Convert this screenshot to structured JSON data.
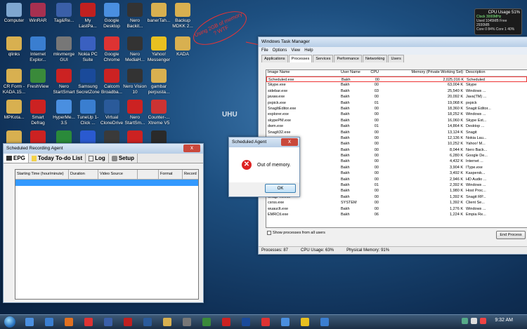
{
  "desktop_icons": [
    {
      "label": "Computer",
      "color": "#7fa7d0"
    },
    {
      "label": "WinRAR",
      "color": "#a73050"
    },
    {
      "label": "Tag&Re...",
      "color": "#3a5fa8"
    },
    {
      "label": "My LastPa...",
      "color": "#c02020"
    },
    {
      "label": "Google Desktop",
      "color": "#4a8fe0"
    },
    {
      "label": "Nero Backit...",
      "color": "#333"
    },
    {
      "label": "banerTah...",
      "color": "#d8b050"
    },
    {
      "label": "Backup MDKK 2...",
      "color": "#d8b050"
    },
    {
      "label": "qlinks",
      "color": "#d8b050"
    },
    {
      "label": "Internet Explor...",
      "color": "#3a7ed0"
    },
    {
      "label": "mkvmerge GUI",
      "color": "#777"
    },
    {
      "label": "Nokia PC Suite",
      "color": "#3a60c0"
    },
    {
      "label": "Google Chrome",
      "color": "#d33"
    },
    {
      "label": "Nero MediaH...",
      "color": "#333"
    },
    {
      "label": "Yahoo! Messenger",
      "color": "#e8c020"
    },
    {
      "label": "KADA",
      "color": "#d8b050"
    },
    {
      "label": "CR Form - KADA.15...",
      "color": "#d8b050"
    },
    {
      "label": "FreshView",
      "color": "#3a8a3a"
    },
    {
      "label": "Nero StartSmart",
      "color": "#c22"
    },
    {
      "label": "Samsung SecretZone",
      "color": "#1a4a9a"
    },
    {
      "label": "Calcom Broadba...",
      "color": "#c22"
    },
    {
      "label": "Nero Vision 10",
      "color": "#333"
    },
    {
      "label": "gambar perpusta...",
      "color": "#d8b050"
    },
    {
      "label": "MPKota...",
      "color": "#d8b050"
    },
    {
      "label": "Smart Defrag",
      "color": "#c22"
    },
    {
      "label": "HyperMe... 3.5",
      "color": "#4a8fe0"
    },
    {
      "label": "TuneUp 1-Click ...",
      "color": "#3a7ed0"
    },
    {
      "label": "Virtual CloneDrive",
      "color": "#2a5a9a"
    },
    {
      "label": "Nero StartSm...",
      "color": "#c22"
    },
    {
      "label": "Counter-... Xtreme V5",
      "color": "#c33"
    },
    {
      "label": "",
      "color": "#d8b050"
    },
    {
      "label": "",
      "color": "#c22"
    },
    {
      "label": "",
      "color": "#2a8a3a"
    },
    {
      "label": "",
      "color": "#2a5ad0"
    },
    {
      "label": "",
      "color": "#3a3a3a"
    },
    {
      "label": "",
      "color": "#c22"
    },
    {
      "label": "",
      "color": "#2a2a2a"
    }
  ],
  "gadget": {
    "title": "CPU Usage 51%",
    "line1": "Clock 3000MHz",
    "line2": "Used 1045MB Free 2930MB",
    "line3": "Core 0 84% Core 1 40%"
  },
  "annotation": "Using 2GB of memory ? WTF",
  "sra": {
    "title": "Scheduled Recording Agent",
    "close": "x",
    "tabs": [
      {
        "label": "EPG",
        "icon": "tv-icon"
      },
      {
        "label": "Today To-do List",
        "icon": "note-icon"
      },
      {
        "label": "Log",
        "icon": "log-icon"
      },
      {
        "label": "Setup",
        "icon": "tools-icon"
      }
    ],
    "columns": [
      "Starting Time (hour/minute)",
      "Duration",
      "Video Source",
      "",
      "Format",
      "Record"
    ]
  },
  "tm": {
    "title": "Windows Task Manager",
    "menu": [
      "File",
      "Options",
      "View",
      "Help"
    ],
    "tabs": [
      "Applications",
      "Processes",
      "Services",
      "Performance",
      "Networking",
      "Users"
    ],
    "columns": [
      "Image Name",
      "User Name",
      "CPU",
      "Memory (Private Working Set)",
      "Description"
    ],
    "rows": [
      [
        "Scheduled.exe",
        "Bakh",
        "00",
        "2,025,016 K",
        "Scheduled"
      ],
      [
        "Skype.exe",
        "Bakh",
        "00",
        "63,004 K",
        "Skype"
      ],
      [
        "sidebar.exe",
        "Bakh",
        "03",
        "25,540 K",
        "Windows ..."
      ],
      [
        "javaw.exe",
        "Bakh",
        "00",
        "20,092 K",
        "Java(TM) ..."
      ],
      [
        "pxpick.exe",
        "Bakh",
        "01",
        "19,068 K",
        "pxpick"
      ],
      [
        "SnagItEditor.exe",
        "Bakh",
        "00",
        "18,360 K",
        "Snagit Editor..."
      ],
      [
        "explorer.exe",
        "Bakh",
        "00",
        "18,252 K",
        "Windows ..."
      ],
      [
        "skypePM.exe",
        "Bakh",
        "00",
        "16,060 K",
        "Skype Ext..."
      ],
      [
        "dwm.exe",
        "Bakh",
        "01",
        "14,864 K",
        "Desktop ..."
      ],
      [
        "SnagIt32.exe",
        "Bakh",
        "00",
        "13,124 K",
        "Snagit"
      ],
      [
        "...exe",
        "Bakh",
        "00",
        "12,136 K",
        "Nokia Lau..."
      ],
      [
        "...exe",
        "Bakh",
        "00",
        "10,252 K",
        "Yahoo! M..."
      ],
      [
        "...exe",
        "Bakh",
        "00",
        "8,044 K",
        "Nero Back..."
      ],
      [
        "...exe",
        "Bakh",
        "00",
        "6,280 K",
        "Google De..."
      ],
      [
        "...exe",
        "Bakh",
        "00",
        "4,432 K",
        "Internet ..."
      ],
      [
        "...exe",
        "Bakh",
        "00",
        "3,904 K",
        "IType.exe"
      ],
      [
        "...exe",
        "Bakh",
        "00",
        "3,492 K",
        "Kaspersk..."
      ],
      [
        "...exe",
        "Bakh",
        "00",
        "2,946 K",
        "HD Audio ..."
      ],
      [
        "...exe",
        "Bakh",
        "01",
        "2,392 K",
        "Windows ..."
      ],
      [
        "...exe",
        "Bakh",
        "00",
        "1,980 K",
        "Host Proc..."
      ],
      [
        "SnagPriv.exe",
        "Bakh",
        "00",
        "1,392 K",
        "Snagit RP..."
      ],
      [
        "csrss.exe",
        "SYSTEM",
        "00",
        "1,392 K",
        "Client Se..."
      ],
      [
        "wuauclt.exe",
        "Bakh",
        "00",
        "1,276 K",
        "Windows ..."
      ],
      [
        "EMRCtl.exe",
        "Bakh",
        "06",
        "1,224 K",
        "Empia Re..."
      ]
    ],
    "show_all": "Show processes from all users",
    "end_process": "End Process",
    "status": [
      "Processes: 87",
      "CPU Usage: 63%",
      "Physical Memory: 91%"
    ]
  },
  "dialog": {
    "title": "Scheduled Agent",
    "message": "Out of memory.",
    "ok": "OK",
    "close": "x"
  },
  "desktop_text": "UHU",
  "taskbar": {
    "clock": "9:32 AM",
    "items": [
      "#4a8fe0",
      "#3a7ed0",
      "#e07020",
      "#d33",
      "#3a5fa8",
      "#c02020",
      "#2a5a9a",
      "#d8b050",
      "#777",
      "#3a8a3a",
      "#c22",
      "#1a4a9a",
      "#d33",
      "#4a8fe0",
      "#e8c020",
      "#3a7ed0"
    ]
  }
}
